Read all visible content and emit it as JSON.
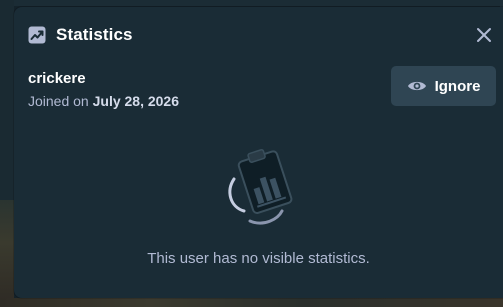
{
  "modal": {
    "title": "Statistics",
    "title_icon": "trending-up-icon",
    "close_icon": "close-icon"
  },
  "user": {
    "username": "crickere",
    "joined_prefix": "Joined on",
    "joined_date": "July 28, 2026"
  },
  "actions": {
    "ignore_label": "Ignore",
    "ignore_icon": "eye-icon"
  },
  "empty_state": {
    "icon": "clipboard-chart-icon",
    "message": "This user has no visible statistics."
  },
  "colors": {
    "modal_bg": "#1a2c36",
    "button_bg": "#2f4553",
    "text_primary": "#ffffff",
    "text_secondary": "#b1bad3"
  }
}
